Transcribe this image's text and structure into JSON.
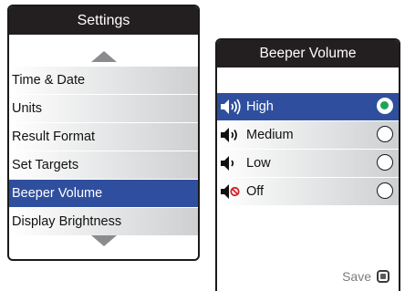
{
  "settings": {
    "title": "Settings",
    "items": [
      {
        "label": "Time & Date",
        "selected": false
      },
      {
        "label": "Units",
        "selected": false
      },
      {
        "label": "Result Format",
        "selected": false
      },
      {
        "label": "Set Targets",
        "selected": false
      },
      {
        "label": "Beeper Volume",
        "selected": true
      },
      {
        "label": "Display Brightness",
        "selected": false
      }
    ],
    "scroll_up_icon": "triangle-up-icon",
    "scroll_down_icon": "triangle-down-icon"
  },
  "beeper": {
    "title": "Beeper Volume",
    "options": [
      {
        "label": "High",
        "icon": "speaker-high-icon",
        "checked": true
      },
      {
        "label": "Medium",
        "icon": "speaker-medium-icon",
        "checked": false
      },
      {
        "label": "Low",
        "icon": "speaker-low-icon",
        "checked": false
      },
      {
        "label": "Off",
        "icon": "speaker-off-icon",
        "checked": false
      }
    ],
    "save_label": "Save",
    "save_icon": "save-button-icon"
  },
  "colors": {
    "header_bg": "#231f20",
    "selected_bg": "#2f4f9e",
    "radio_checked": "#1fa25a",
    "mute_red": "#d2232a"
  }
}
